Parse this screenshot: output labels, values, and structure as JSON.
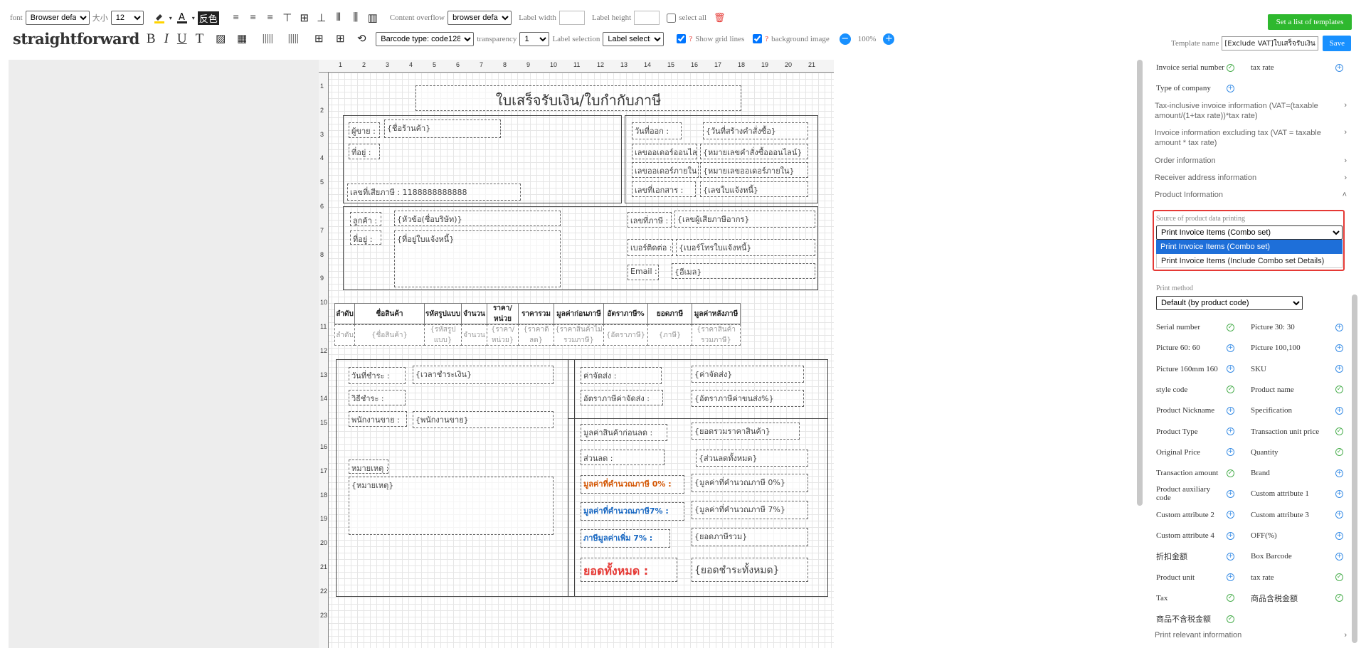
{
  "toolbar": {
    "font_label": "font",
    "font_value": "Browser defa",
    "size_label": "大小",
    "size_value": "12",
    "fancolor": "反色",
    "content_overflow_label": "Content overflow",
    "content_overflow_value": "browser defa",
    "label_width_label": "Label width",
    "label_height_label": "Label height",
    "select_all": "select all",
    "straightforward": "straightforward",
    "bold": "B",
    "italic": "I",
    "underline": "U",
    "text_tool": "T",
    "barcode_type": "Barcode type: code128",
    "transparency_label": "transparency",
    "transparency_value": "1",
    "label_selection_label": "Label selection",
    "label_selection_value": "Label selectio",
    "show_grid": "Show grid lines",
    "bg_image": "background image",
    "zoom": "100%",
    "set_templates": "Set a list of templates",
    "template_name_label": "Template name",
    "template_name_value": "[Exclude VAT]ใบเสร็จรับเงิน",
    "save": "Save",
    "accent": "#1890ff",
    "green": "#2eb82e"
  },
  "ruler": {
    "top": [
      "1",
      "2",
      "3",
      "4",
      "5",
      "6",
      "7",
      "8",
      "9",
      "10",
      "11",
      "12",
      "13",
      "14",
      "15",
      "16",
      "17",
      "18",
      "19",
      "20",
      "21"
    ],
    "left": [
      "1",
      "2",
      "3",
      "4",
      "5",
      "6",
      "7",
      "8",
      "9",
      "10",
      "11",
      "12",
      "13",
      "14",
      "15",
      "16",
      "17",
      "18",
      "19",
      "20",
      "21",
      "22",
      "23"
    ]
  },
  "doc": {
    "title": "ใบเสร็จรับเงิน/ใบกำกับภาษี",
    "seller": "ผู้ขาย :",
    "shop": "{ชื่อร้านค้า}",
    "addr": "ที่อยู่ :",
    "taxid": "เลขที่เสียภาษี : 1188888888888",
    "issue_date": "วันที่ออก :",
    "issue_val": "{วันที่สร้างคำสั่งซื้อ}",
    "online_order": "เลขออเดอร์ออนไลน์",
    "online_val": "{หมายเลขคำสั่งซื้อออนไลน์}",
    "inner_order": "เลขออเดอร์ภายใน :",
    "inner_val": "{หมายเลขออเดอร์ภายใน}",
    "doc_no": "เลขที่เอกสาร :",
    "doc_val": "{เลขใบแจ้งหนี้}",
    "customer": "ลูกค้า :",
    "customer_val": "{หัวข้อ(ชื่อบริษัท)}",
    "caddr": "ที่อยู่ :",
    "caddr_val": "{ที่อยู่ใบแจ้งหนี้}",
    "ctax": "เลขที่ภาษี :",
    "ctax_val": "{เลขผู้เสียภาษีอากร}",
    "phone": "เบอร์ติดต่อ :",
    "phone_val": "{เบอร์โทรใบแจ้งหนี้}",
    "email": "Email :",
    "email_val": "{อีเมล}",
    "headers": [
      "ลำดับ",
      "ชื่อสินค้า",
      "รหัสรูปแบบ",
      "จำนวน",
      "ราคา/หน่วย",
      "ราคารวม",
      "มูลค่าก่อนภาษี",
      "อัตราภาษี%",
      "ยอดภาษี",
      "มูลค่าหลังภาษี"
    ],
    "values": [
      "{ลำดับ}",
      "{ชื่อสินค้า}",
      "{รหัสรูปแบบ}",
      "{จำนวน}",
      "{ราคา/หน่วย}",
      "{ราคาดิลด}",
      "{ราคาสินค้าไม่รวมภาษี}",
      "{อัตราภาษี}",
      "{ภาษี}",
      "{ราคาสินค้ารวมภาษี}"
    ],
    "pay_date": "วันที่ชำระ :",
    "pay_date_val": "{เวลาชำระเงิน}",
    "pay_method": "วิธีชำระ :",
    "sales": "พนักงานขาย :",
    "sales_val": "{พนักงานขาย}",
    "note": "หมายเหตุ :",
    "note_val": "{หมายเหตุ}",
    "ship": "ค่าจัดส่ง :",
    "ship_val": "{ค่าจัดส่ง}",
    "ship_tax": "อัตราภาษีค่าจัดส่ง :",
    "ship_tax_val": "{อัตราภาษีค่าขนส่ง%}",
    "pre_disc": "มูลค่าสินค้าก่อนลด :",
    "pre_disc_val": "{ยอดรวมราคาสินค้า}",
    "disc": "ส่วนลด :",
    "disc_val": "{ส่วนลดทั้งหมด}",
    "tax0": "มูลค่าที่คำนวณภาษี 0% :",
    "tax0_val": "{มูลค่าที่คำนวณภาษี 0%}",
    "tax7": "มูลค่าที่คำนวณภาษี7% :",
    "tax7_val": "{มูลค่าที่คำนวณภาษี 7%}",
    "vat": "ภาษีมูลค่าเพิ่ม 7% :",
    "vat_val": "{ยอดภาษีรวม}",
    "total": "ยอดทั้งหมด :",
    "total_val": "{ยอดชำระทั้งหมด}"
  },
  "panel": {
    "top_a": "Invoice serial number",
    "top_b": "tax rate",
    "company": "Type of company",
    "sec1": "Tax-inclusive invoice information (VAT=(taxable amount/(1+tax rate))*tax rate)",
    "sec2": "Invoice information excluding tax (VAT = taxable amount * tax rate)",
    "sec3": "Order information",
    "sec4": "Receiver address information",
    "sec5": "Product Information",
    "source_label": "Source of product data printing",
    "source_value": "Print Invoice Items (Combo set)",
    "opt1": "Print Invoice Items (Combo set)",
    "opt2": "Print Invoice Items (Include Combo set Details)",
    "print_method_label": "Print method",
    "print_method_value": "Default (by product code)",
    "items": [
      [
        "Serial number",
        "g",
        "Picture 30: 30",
        "b"
      ],
      [
        "Picture 60: 60",
        "b",
        "Picture 100,100",
        "b"
      ],
      [
        "Picture 160mm 160",
        "b",
        "SKU",
        "b"
      ],
      [
        "style code",
        "g",
        "Product name",
        "g"
      ],
      [
        "Product Nickname",
        "b",
        "Specification",
        "b"
      ],
      [
        "Product Type",
        "b",
        "Transaction unit price",
        "g"
      ],
      [
        "Original Price",
        "b",
        "Quantity",
        "g"
      ],
      [
        "Transaction amount",
        "g",
        "Brand",
        "b"
      ],
      [
        "Product auxiliary code",
        "b",
        "Custom attribute 1",
        "b"
      ],
      [
        "Custom attribute 2",
        "b",
        "Custom attribute 3",
        "b"
      ],
      [
        "Custom attribute 4",
        "b",
        "OFF(%)",
        "b"
      ],
      [
        "折扣金额",
        "b",
        "Box Barcode",
        "b"
      ],
      [
        "Product unit",
        "b",
        "tax rate",
        "g"
      ],
      [
        "Tax",
        "g",
        "商品含税金额",
        "g"
      ],
      [
        "商品不含税金额",
        "g",
        "",
        ""
      ]
    ],
    "sec6": "Print relevant information",
    "highlight": "#e53935"
  }
}
